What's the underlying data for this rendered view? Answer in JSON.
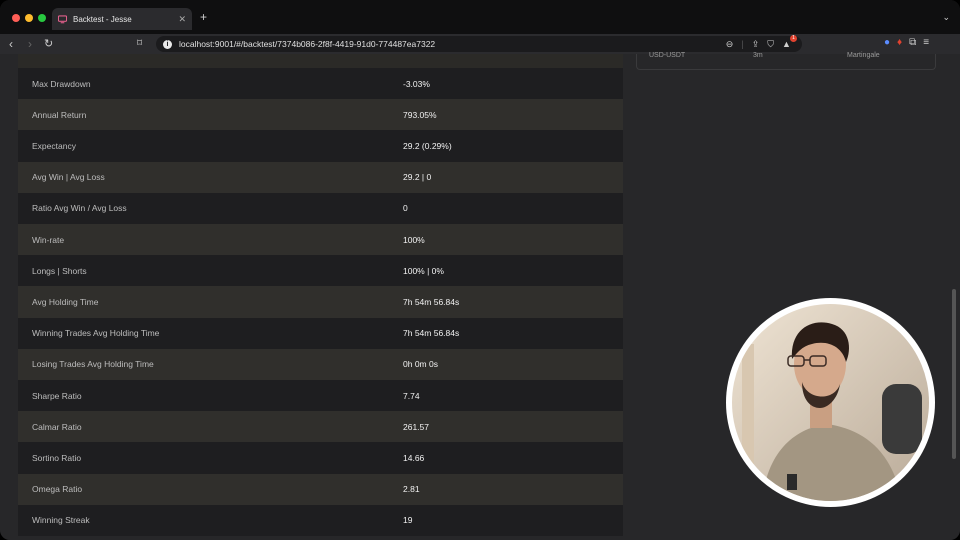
{
  "browser": {
    "tab_title": "Backtest - Jesse",
    "url": "localhost:9001/#/backtest/7374b086-2f8f-4419-91d0-774487ea7322"
  },
  "metrics": [
    {
      "label": "Max Drawdown",
      "value": "-3.03%"
    },
    {
      "label": "Annual Return",
      "value": "793.05%"
    },
    {
      "label": "Expectancy",
      "value": "29.2 (0.29%)"
    },
    {
      "label": "Avg Win | Avg Loss",
      "value": "29.2 | 0"
    },
    {
      "label": "Ratio Avg Win / Avg Loss",
      "value": "0"
    },
    {
      "label": "Win-rate",
      "value": "100%"
    },
    {
      "label": "Longs | Shorts",
      "value": "100% | 0%"
    },
    {
      "label": "Avg Holding Time",
      "value": "7h 54m 56.84s"
    },
    {
      "label": "Winning Trades Avg Holding Time",
      "value": "7h 54m 56.84s"
    },
    {
      "label": "Losing Trades Avg Holding Time",
      "value": "0h 0m 0s"
    },
    {
      "label": "Sharpe Ratio",
      "value": "7.74"
    },
    {
      "label": "Calmar Ratio",
      "value": "261.57"
    },
    {
      "label": "Sortino Ratio",
      "value": "14.66"
    },
    {
      "label": "Omega Ratio",
      "value": "2.81"
    },
    {
      "label": "Winning Streak",
      "value": "19"
    }
  ],
  "right_panel": {
    "col1": "USD-USDT",
    "col2": "3m",
    "col3": "Martingale"
  },
  "colors": {
    "row_dark": "#1e1e20",
    "row_light": "#302f2c",
    "background": "#272729"
  }
}
